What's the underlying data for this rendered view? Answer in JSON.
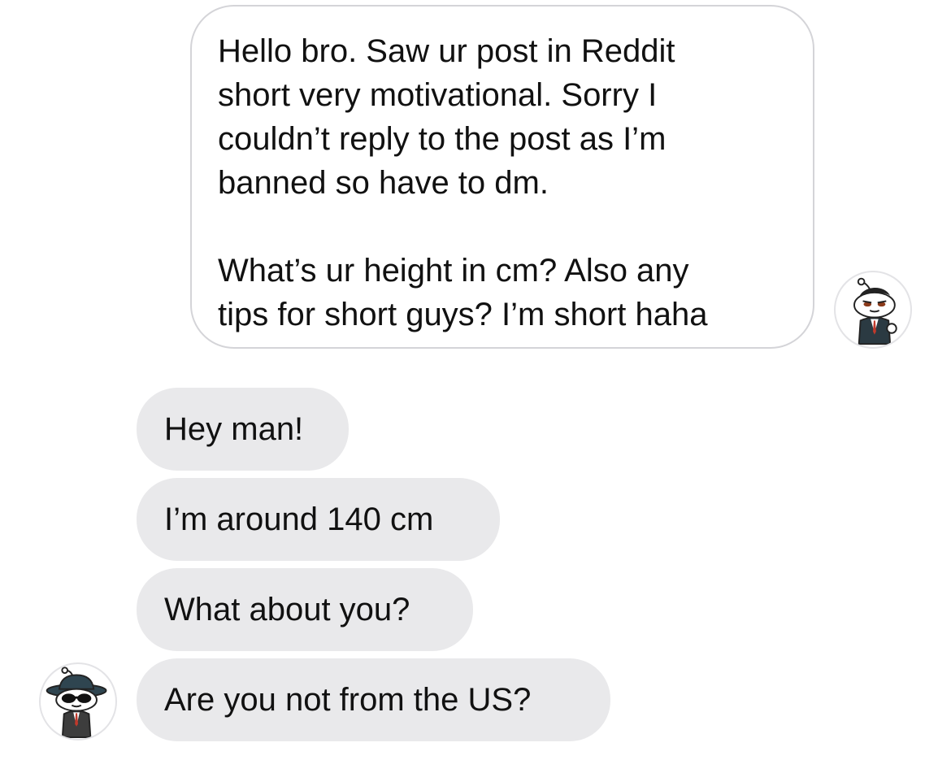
{
  "conversation": {
    "outgoing": [
      {
        "text": "Hello bro. Saw ur post in Reddit\nshort very motivational. Sorry I\ncouldn’t reply to the post as I’m\nbanned so have to dm.\n\nWhat’s ur height in cm? Also any\ntips for short guys? I’m short haha"
      }
    ],
    "incoming": [
      {
        "text": "Hey man!"
      },
      {
        "text": "I’m around 140 cm"
      },
      {
        "text": "What about you?"
      },
      {
        "text": "Are you not from the US?"
      }
    ]
  },
  "avatars": {
    "self": {
      "icon": "reddit-snoo-avatar-icon"
    },
    "other": {
      "icon": "reddit-snoo-hat-sunglasses-avatar-icon"
    }
  },
  "colors": {
    "incoming_bubble": "#e9e9eb",
    "outgoing_border": "#d4d4d8",
    "text": "#111111"
  }
}
